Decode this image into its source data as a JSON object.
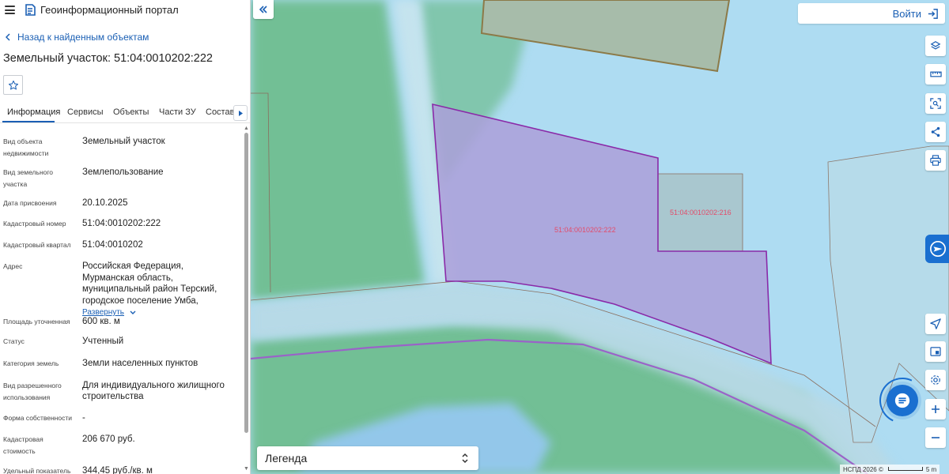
{
  "app": {
    "title": "Геоинформационный портал"
  },
  "panel": {
    "back_label": "Назад к найденным объектам",
    "object_title": "Земельный участок: 51:04:0010202:222",
    "tabs": [
      {
        "label": "Информация",
        "active": true
      },
      {
        "label": "Сервисы"
      },
      {
        "label": "Объекты"
      },
      {
        "label": "Части ЗУ"
      },
      {
        "label": "Состав"
      }
    ],
    "expand_label": "Развернуть",
    "info": [
      {
        "label": "Вид объекта недвижимости",
        "value": "Земельный участок"
      },
      {
        "label": "Вид земельного участка",
        "value": "Землепользование"
      },
      {
        "label": "Дата присвоения",
        "value": "20.10.2025"
      },
      {
        "label": "Кадастровый номер",
        "value": "51:04:0010202:222"
      },
      {
        "label": "Кадастровый квартал",
        "value": "51:04:0010202"
      },
      {
        "label": "Адрес",
        "value": "Российская Федерация, Мурманская область, муниципальный район Терский, городское поселение Умба,"
      },
      {
        "label": "Площадь уточненная",
        "value": "600 кв. м"
      },
      {
        "label": "Статус",
        "value": "Учтенный"
      },
      {
        "label": "Категория земель",
        "value": "Земли населенных пунктов"
      },
      {
        "label": "Вид разрешенного использования",
        "value": "Для индивидуального жилищного строительства"
      },
      {
        "label": "Форма собственности",
        "value": "-"
      },
      {
        "label": "Кадастровая стоимость",
        "value": "206 670 руб."
      },
      {
        "label": "Удельный показатель",
        "value": "344,45 руб./кв. м"
      }
    ]
  },
  "map": {
    "login_label": "Войти",
    "legend_label": "Легенда",
    "parcel_main_label": "51:04:0010202:222",
    "parcel_side_label": "51:04:0010202:216",
    "attribution": "НСПД 2026 ©",
    "scale_label": "5 m",
    "tools": [
      "layers-icon",
      "ruler-icon",
      "select-area-icon",
      "share-icon",
      "print-icon"
    ],
    "nav_tools": [
      "locate-icon",
      "minimap-icon",
      "geolocation-icon",
      "zoom-in-icon",
      "zoom-out-icon"
    ]
  },
  "colors": {
    "accent": "#1a5fb4",
    "parcel_stroke": "#8a2aa8",
    "parcel_fill": "#b09ad6",
    "water": "#aedcf2",
    "land": "#72bf95"
  }
}
